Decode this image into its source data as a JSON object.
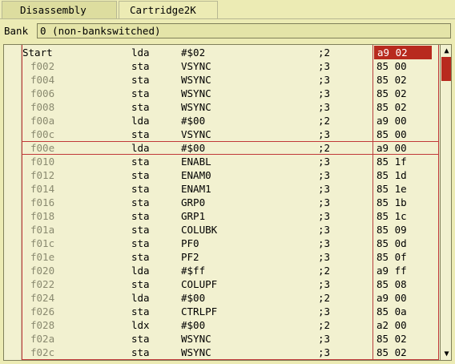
{
  "tabs": [
    {
      "label": "Disassembly",
      "active": true
    },
    {
      "label": "Cartridge2K",
      "active": false
    }
  ],
  "bank": {
    "label": "Bank",
    "value": "0 (non-bankswitched)"
  },
  "rows": [
    {
      "label": "Start",
      "op": "lda",
      "arg": "#$02",
      "cycles": ";2",
      "bytes": "a9 02",
      "is_label": true
    },
    {
      "label": "f002",
      "op": "sta",
      "arg": "VSYNC",
      "cycles": ";3",
      "bytes": "85 00"
    },
    {
      "label": "f004",
      "op": "sta",
      "arg": "WSYNC",
      "cycles": ";3",
      "bytes": "85 02"
    },
    {
      "label": "f006",
      "op": "sta",
      "arg": "WSYNC",
      "cycles": ";3",
      "bytes": "85 02"
    },
    {
      "label": "f008",
      "op": "sta",
      "arg": "WSYNC",
      "cycles": ";3",
      "bytes": "85 02"
    },
    {
      "label": "f00a",
      "op": "lda",
      "arg": "#$00",
      "cycles": ";2",
      "bytes": "a9 00"
    },
    {
      "label": "f00c",
      "op": "sta",
      "arg": "VSYNC",
      "cycles": ";3",
      "bytes": "85 00"
    },
    {
      "label": "f00e",
      "op": "lda",
      "arg": "#$00",
      "cycles": ";2",
      "bytes": "a9 00"
    },
    {
      "label": "f010",
      "op": "sta",
      "arg": "ENABL",
      "cycles": ";3",
      "bytes": "85 1f"
    },
    {
      "label": "f012",
      "op": "sta",
      "arg": "ENAM0",
      "cycles": ";3",
      "bytes": "85 1d"
    },
    {
      "label": "f014",
      "op": "sta",
      "arg": "ENAM1",
      "cycles": ";3",
      "bytes": "85 1e"
    },
    {
      "label": "f016",
      "op": "sta",
      "arg": "GRP0",
      "cycles": ";3",
      "bytes": "85 1b"
    },
    {
      "label": "f018",
      "op": "sta",
      "arg": "GRP1",
      "cycles": ";3",
      "bytes": "85 1c"
    },
    {
      "label": "f01a",
      "op": "sta",
      "arg": "COLUBK",
      "cycles": ";3",
      "bytes": "85 09"
    },
    {
      "label": "f01c",
      "op": "sta",
      "arg": "PF0",
      "cycles": ";3",
      "bytes": "85 0d"
    },
    {
      "label": "f01e",
      "op": "sta",
      "arg": "PF2",
      "cycles": ";3",
      "bytes": "85 0f"
    },
    {
      "label": "f020",
      "op": "lda",
      "arg": "#$ff",
      "cycles": ";2",
      "bytes": "a9 ff"
    },
    {
      "label": "f022",
      "op": "sta",
      "arg": "COLUPF",
      "cycles": ";3",
      "bytes": "85 08"
    },
    {
      "label": "f024",
      "op": "lda",
      "arg": "#$00",
      "cycles": ";2",
      "bytes": "a9 00"
    },
    {
      "label": "f026",
      "op": "sta",
      "arg": "CTRLPF",
      "cycles": ";3",
      "bytes": "85 0a"
    },
    {
      "label": "f028",
      "op": "ldx",
      "arg": "#$00",
      "cycles": ";2",
      "bytes": "a2 00"
    },
    {
      "label": "f02a",
      "op": "sta",
      "arg": "WSYNC",
      "cycles": ";3",
      "bytes": "85 02"
    },
    {
      "label": "f02c",
      "op": "sta",
      "arg": "WSYNC",
      "cycles": ";3",
      "bytes": "85 02"
    }
  ],
  "pc_row": 0,
  "selected_row": 7,
  "scrollbar": {
    "up_icon": "arrow-up-icon",
    "down_icon": "arrow-down-icon"
  }
}
